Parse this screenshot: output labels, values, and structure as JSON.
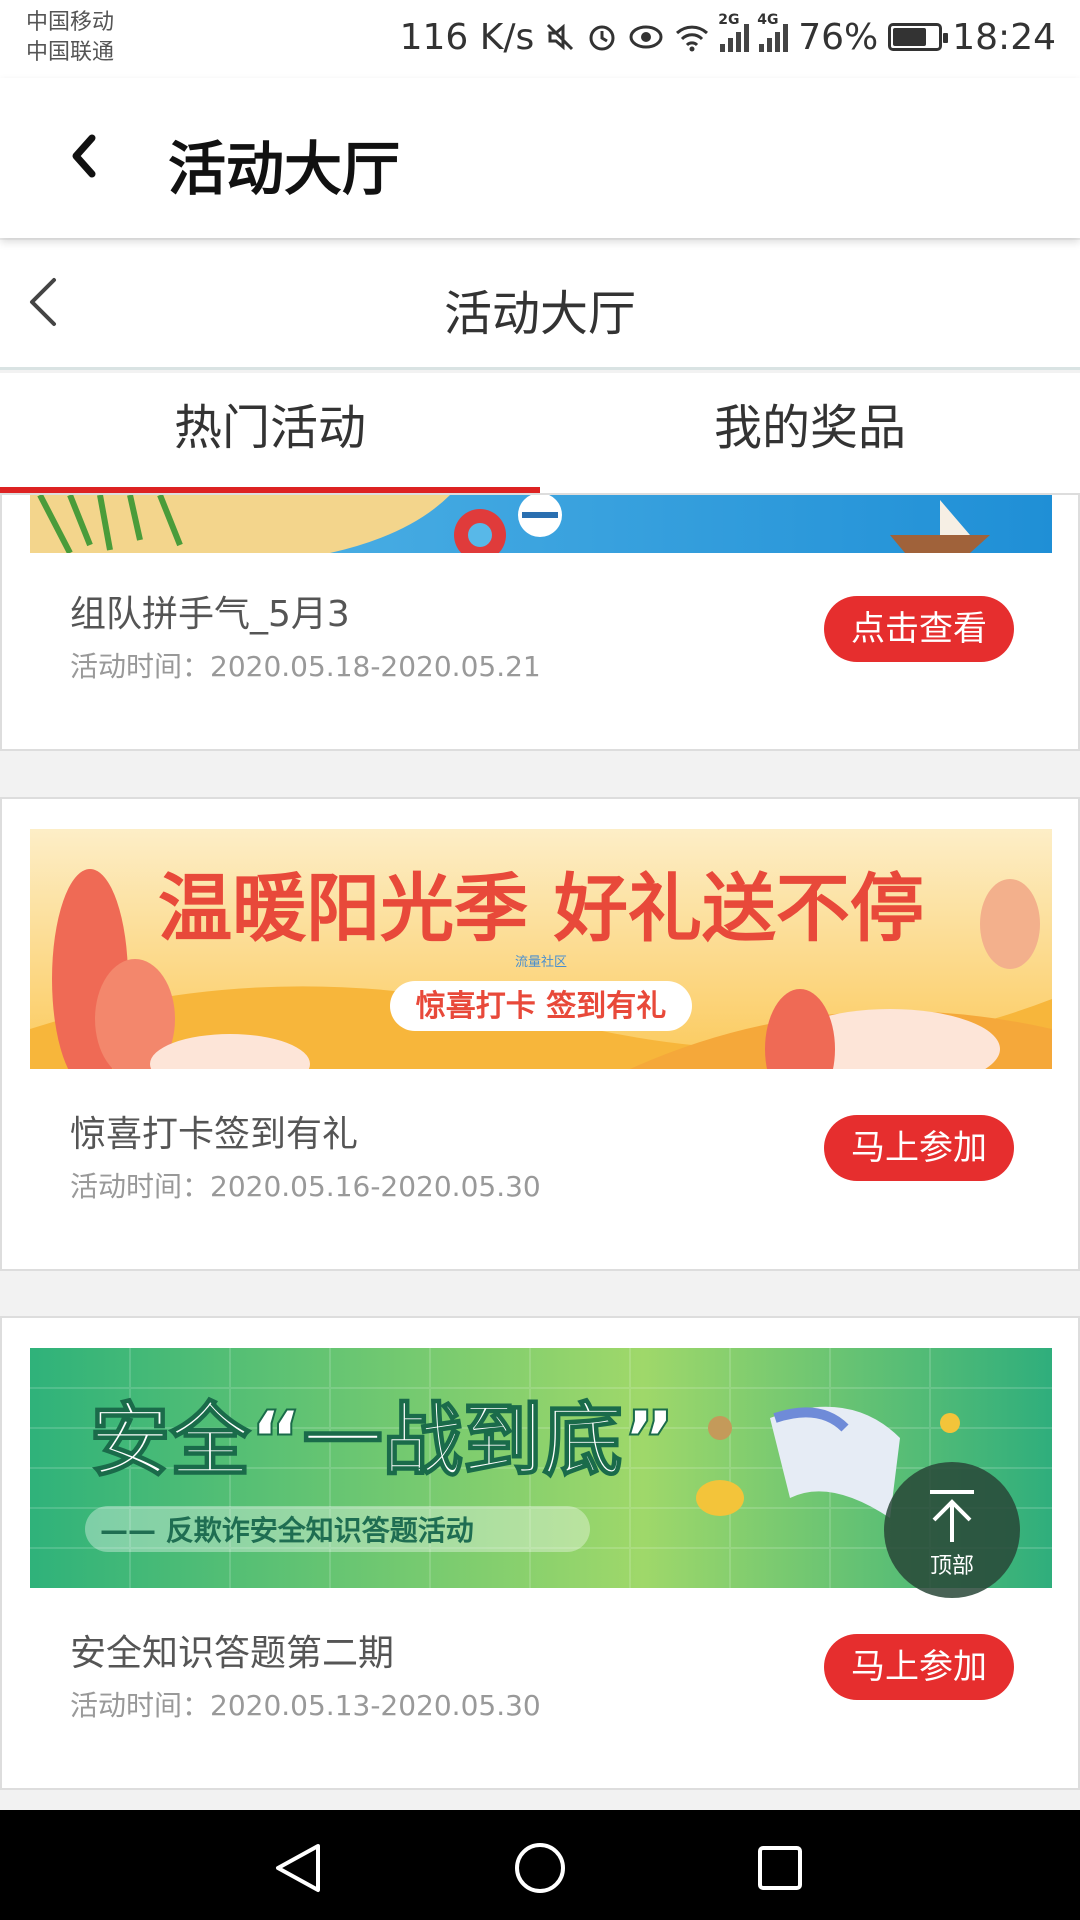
{
  "status_bar": {
    "carrier1": "中国移动",
    "carrier2": "中国联通",
    "speed": "116 K/s",
    "net1": "2G",
    "net2": "4G",
    "battery": "76%",
    "battery_level": 0.76,
    "time": "18:24"
  },
  "app_bar": {
    "title": "活动大厅"
  },
  "web_header": {
    "title": "活动大厅"
  },
  "tabs": [
    {
      "label": "热门活动",
      "active": true
    },
    {
      "label": "我的奖品",
      "active": false
    }
  ],
  "activities": [
    {
      "title": "组队拼手气_5月3",
      "time": "活动时间：2020.05.18-2020.05.21",
      "button": "点击查看"
    },
    {
      "title": "惊喜打卡签到有礼",
      "time": "活动时间：2020.05.16-2020.05.30",
      "button": "马上参加",
      "banner": {
        "headline": "温暖阳光季  好礼送不停",
        "watermark": "流量社区",
        "pill": "惊喜打卡 签到有礼"
      }
    },
    {
      "title": "安全知识答题第二期",
      "time": "活动时间：2020.05.13-2020.05.30",
      "button": "马上参加",
      "banner": {
        "headline": "安全“一战到底”",
        "subtitle": "—— 反欺诈安全知识答题活动"
      }
    }
  ],
  "back_to_top": {
    "label": "顶部"
  },
  "colors": {
    "accent": "#e62e2e",
    "tab_indicator": "#dd2222"
  }
}
